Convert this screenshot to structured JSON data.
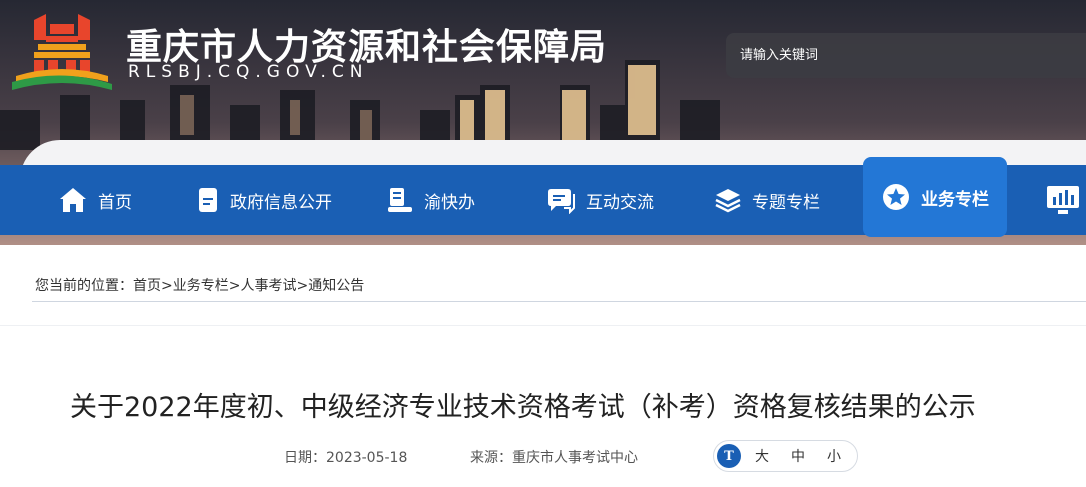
{
  "header": {
    "site_title": "重庆市人力资源和社会保障局",
    "site_domain": "RLSBJ.CQ.GOV.CN",
    "search_placeholder": "请输入关键词"
  },
  "nav": {
    "items": [
      {
        "label": "首页",
        "icon": "home-icon"
      },
      {
        "label": "政府信息公开",
        "icon": "document-icon"
      },
      {
        "label": "渝快办",
        "icon": "service-icon"
      },
      {
        "label": "互动交流",
        "icon": "chat-icon"
      },
      {
        "label": "专题专栏",
        "icon": "layers-icon"
      },
      {
        "label": "业务专栏",
        "icon": "star-icon",
        "active": true
      },
      {
        "label": "",
        "icon": "monitor-chart-icon"
      }
    ]
  },
  "breadcrumb": {
    "prefix": "您当前的位置：",
    "items": [
      "首页",
      "业务专栏",
      "人事考试",
      "通知公告"
    ],
    "separator": ">"
  },
  "article": {
    "title": "关于2022年度初、中级经济专业技术资格考试（补考）资格复核结果的公示",
    "date_label": "日期：",
    "date": "2023-05-18",
    "source_label": "来源：",
    "source": "重庆市人事考试中心",
    "font_sizes": [
      "大",
      "中",
      "小"
    ],
    "font_icon": "T"
  },
  "colors": {
    "nav_bg": "#1a5fb4",
    "nav_active": "#2377d6"
  }
}
